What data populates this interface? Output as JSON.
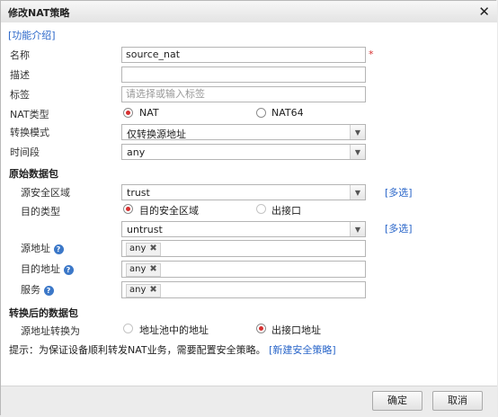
{
  "dialog": {
    "title": "修改NAT策略"
  },
  "help_link": "[功能介绍]",
  "fields": {
    "name": {
      "label": "名称",
      "value": "source_nat",
      "required": "*"
    },
    "description": {
      "label": "描述",
      "value": ""
    },
    "tags": {
      "label": "标签",
      "placeholder": "请选择或输入标签"
    },
    "nat_type": {
      "label": "NAT类型",
      "options": [
        "NAT",
        "NAT64"
      ],
      "selected": "NAT"
    },
    "translation_mode": {
      "label": "转换模式",
      "value": "仅转换源地址"
    },
    "time_range": {
      "label": "时间段",
      "value": "any"
    }
  },
  "original_packet": {
    "heading": "原始数据包",
    "source_zone": {
      "label": "源安全区域",
      "value": "trust",
      "more": "[多选]"
    },
    "dest_type": {
      "label": "目的类型",
      "options": [
        "目的安全区域",
        "出接口"
      ],
      "selected": "目的安全区域"
    },
    "dest_zone": {
      "value": "untrust",
      "more": "[多选]"
    },
    "source_address": {
      "label": "源地址",
      "tag": "any"
    },
    "dest_address": {
      "label": "目的地址",
      "tag": "any"
    },
    "service": {
      "label": "服务",
      "tag": "any"
    }
  },
  "translated_packet": {
    "heading": "转换后的数据包",
    "source_translate": {
      "label": "源地址转换为",
      "options": [
        "地址池中的地址",
        "出接口地址"
      ],
      "selected": "出接口地址"
    }
  },
  "hint": {
    "text": "提示：为保证设备顺利转发NAT业务，需要配置安全策略。",
    "link": "[新建安全策略]"
  },
  "buttons": {
    "ok": "确定",
    "cancel": "取消"
  },
  "icons": {
    "close": "close-icon",
    "dropdown": "chevron-down-icon",
    "help": "help-icon",
    "remove_tag": "remove-tag-icon"
  },
  "colors": {
    "selected_radio": "#d63030",
    "link": "#2a66c9",
    "required": "#d63030"
  }
}
